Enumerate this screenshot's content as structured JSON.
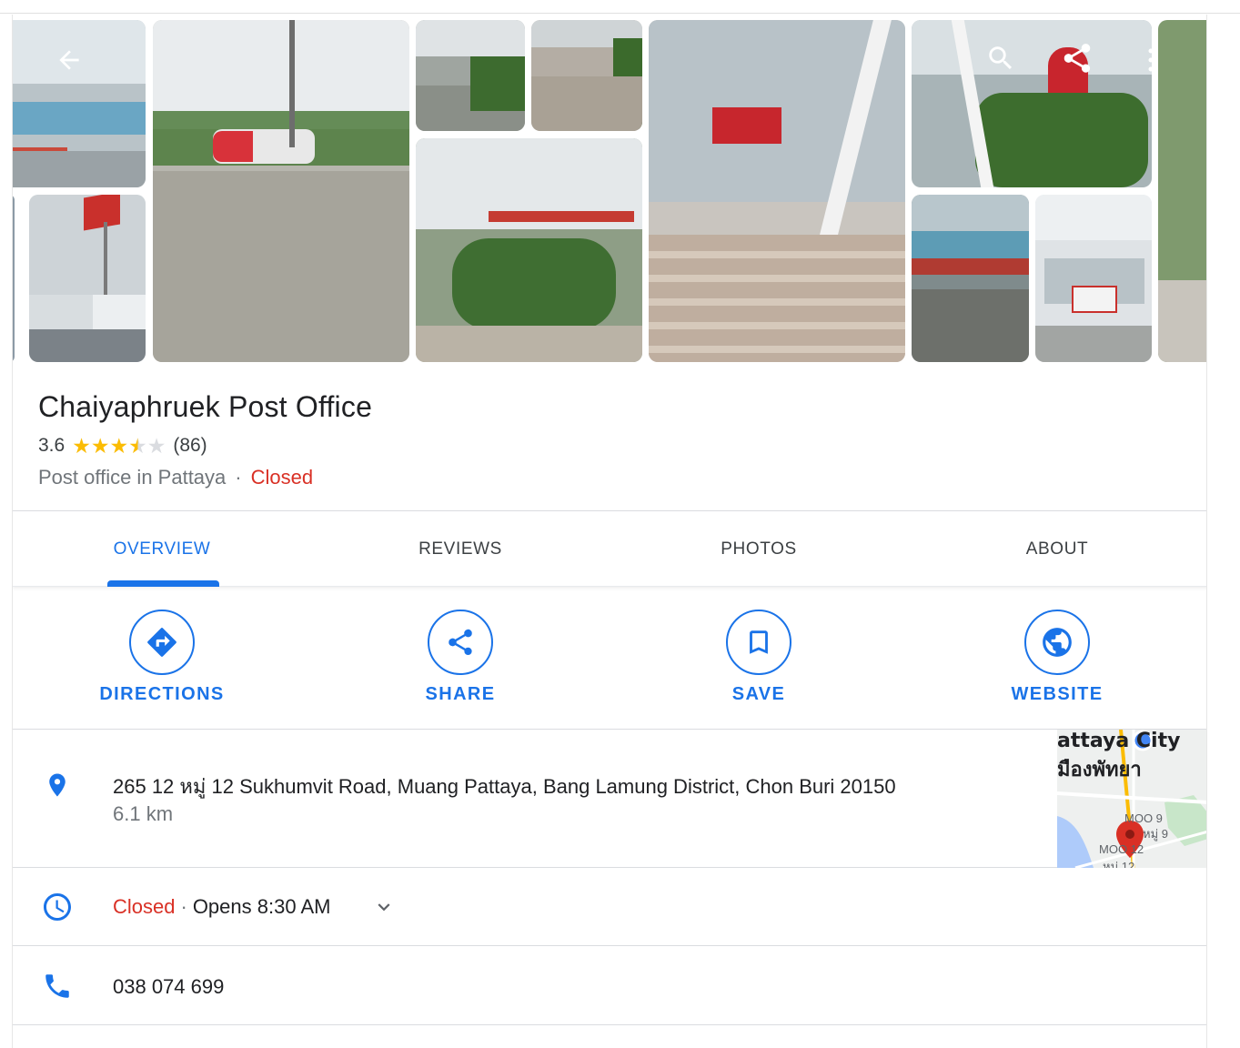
{
  "place": {
    "title": "Chaiyaphruek Post Office",
    "rating": "3.6",
    "rating_value": 3.6,
    "review_count": "(86)",
    "category": "Post office in Pattaya",
    "separator": "·",
    "status": "Closed"
  },
  "tabs": [
    {
      "label": "OVERVIEW",
      "active": true
    },
    {
      "label": "REVIEWS",
      "active": false
    },
    {
      "label": "PHOTOS",
      "active": false
    },
    {
      "label": "ABOUT",
      "active": false
    }
  ],
  "actions": [
    {
      "label": "DIRECTIONS",
      "icon": "directions-icon"
    },
    {
      "label": "SHARE",
      "icon": "share-icon"
    },
    {
      "label": "SAVE",
      "icon": "bookmark-icon"
    },
    {
      "label": "WEBSITE",
      "icon": "globe-icon"
    }
  ],
  "details": {
    "address": "265 12 หมู่ 12 Sukhumvit Road, Muang Pattaya, Bang Lamung District, Chon Buri 20150",
    "distance": "6.1 km",
    "hours_status": "Closed",
    "hours_separator": "·",
    "hours_next": "Opens 8:30 AM",
    "phone": "038 074 699"
  },
  "map": {
    "label_city": "attaya City",
    "label_thai": "มืองพัทยา",
    "label_moo9": "MOO 9",
    "label_moo9_thai": "หมู่ 9",
    "label_moo12": "MOO 12",
    "label_moo12_thai": "หมู่ 12"
  },
  "colors": {
    "accent": "#1a73e8",
    "closed": "#d93025",
    "star": "#fbbc04",
    "text": "#202124",
    "secondary": "#70757a"
  }
}
